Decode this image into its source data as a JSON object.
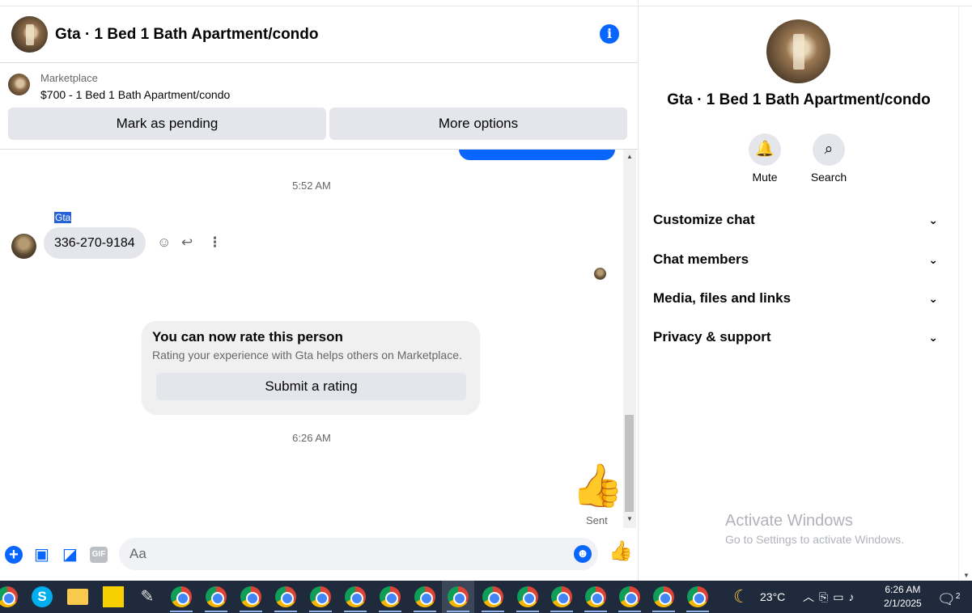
{
  "header": {
    "title": "Gta · 1 Bed 1 Bath Apartment/condo",
    "info_icon": "i"
  },
  "marketplace": {
    "label": "Marketplace",
    "listing": "$700 - 1 Bed 1 Bath Apartment/condo",
    "mark_pending": "Mark as pending",
    "more_options": "More options"
  },
  "messages": {
    "time1": "5:52 AM",
    "sender": "Gta",
    "phone": "336-270-9184",
    "time2": "6:26 AM",
    "sent_label": "Sent"
  },
  "rating": {
    "title": "You can now rate this person",
    "subtitle": "Rating your experience with Gta helps others on Marketplace.",
    "button": "Submit a rating"
  },
  "composer": {
    "placeholder": "Aa",
    "gif": "GIF"
  },
  "info_panel": {
    "title": "Gta · 1 Bed 1 Bath Apartment/condo",
    "mute": "Mute",
    "search": "Search",
    "sections": [
      "Customize chat",
      "Chat members",
      "Media, files and links",
      "Privacy & support"
    ]
  },
  "watermark": {
    "line1": "Activate Windows",
    "line2": "Go to Settings to activate Windows."
  },
  "taskbar": {
    "skype": "S",
    "temperature": "23°C",
    "time": "6:26 AM",
    "date": "2/1/2025",
    "notifications": "2"
  },
  "colors": {
    "accent": "#0866ff",
    "bubble_gray": "#e4e6eb",
    "taskbar": "#1f2a3c"
  }
}
